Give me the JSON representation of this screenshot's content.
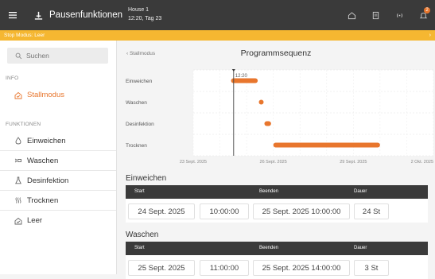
{
  "topbar": {
    "title": "Pausenfunktionen",
    "house_name": "House 1",
    "house_time": "12:20, Tag 23",
    "notification_count": "2"
  },
  "status": {
    "text": "Stop Modus: Leer",
    "arrow": "›"
  },
  "sidebar": {
    "search_placeholder": "Suchen",
    "info_label": "INFO",
    "info_items": [
      {
        "label": "Stallmodus",
        "icon": "house-check-icon",
        "active": true
      }
    ],
    "functions_label": "FUNKTIONEN",
    "function_items": [
      {
        "label": "Einweichen",
        "icon": "drop-icon"
      },
      {
        "label": "Waschen",
        "icon": "spray-icon"
      },
      {
        "label": "Desinfektion",
        "icon": "flask-icon"
      },
      {
        "label": "Trocknen",
        "icon": "heat-icon"
      },
      {
        "label": "Leer",
        "icon": "house-check-icon"
      }
    ]
  },
  "main": {
    "back_label": "‹  Stallmodus",
    "title": "Programmsequenz"
  },
  "colors": {
    "accent": "#e8762d",
    "topbar": "#3a3a3a",
    "status": "#f5b731"
  },
  "chart_data": {
    "type": "gantt",
    "now_label": "12:20",
    "rows": [
      {
        "name": "Einweichen",
        "start": "24 Sept. 2025 10:00",
        "end": "25 Sept. 2025 10:00"
      },
      {
        "name": "Waschen",
        "start": "25 Sept. 2025 11:00",
        "end": "25 Sept. 2025 14:00"
      },
      {
        "name": "Desinfektion",
        "start": "25 Sept. 2025 16:00",
        "end": "25 Sept. 2025 22:00"
      },
      {
        "name": "Trocknen",
        "start": "26 Sept. 2025 00:00",
        "end": "30 Sept. 2025 00:00"
      }
    ],
    "x_ticks": [
      "23 Sept. 2025",
      "26 Sept. 2025",
      "29 Sept. 2025",
      "2 Okt. 2025"
    ],
    "x_range": [
      "23 Sept. 2025",
      "2 Okt. 2025"
    ]
  },
  "steps": [
    {
      "title": "Einweichen",
      "headers": {
        "start": "Start",
        "end": "Beenden",
        "duration": "Dauer"
      },
      "start_date": "24 Sept. 2025",
      "start_time": "10:00:00",
      "end": "25 Sept. 2025 10:00:00",
      "duration": "24 St"
    },
    {
      "title": "Waschen",
      "headers": {
        "start": "Start",
        "end": "Beenden",
        "duration": "Dauer"
      },
      "start_date": "25 Sept. 2025",
      "start_time": "11:00:00",
      "end": "25 Sept. 2025 14:00:00",
      "duration": "3 St"
    }
  ]
}
